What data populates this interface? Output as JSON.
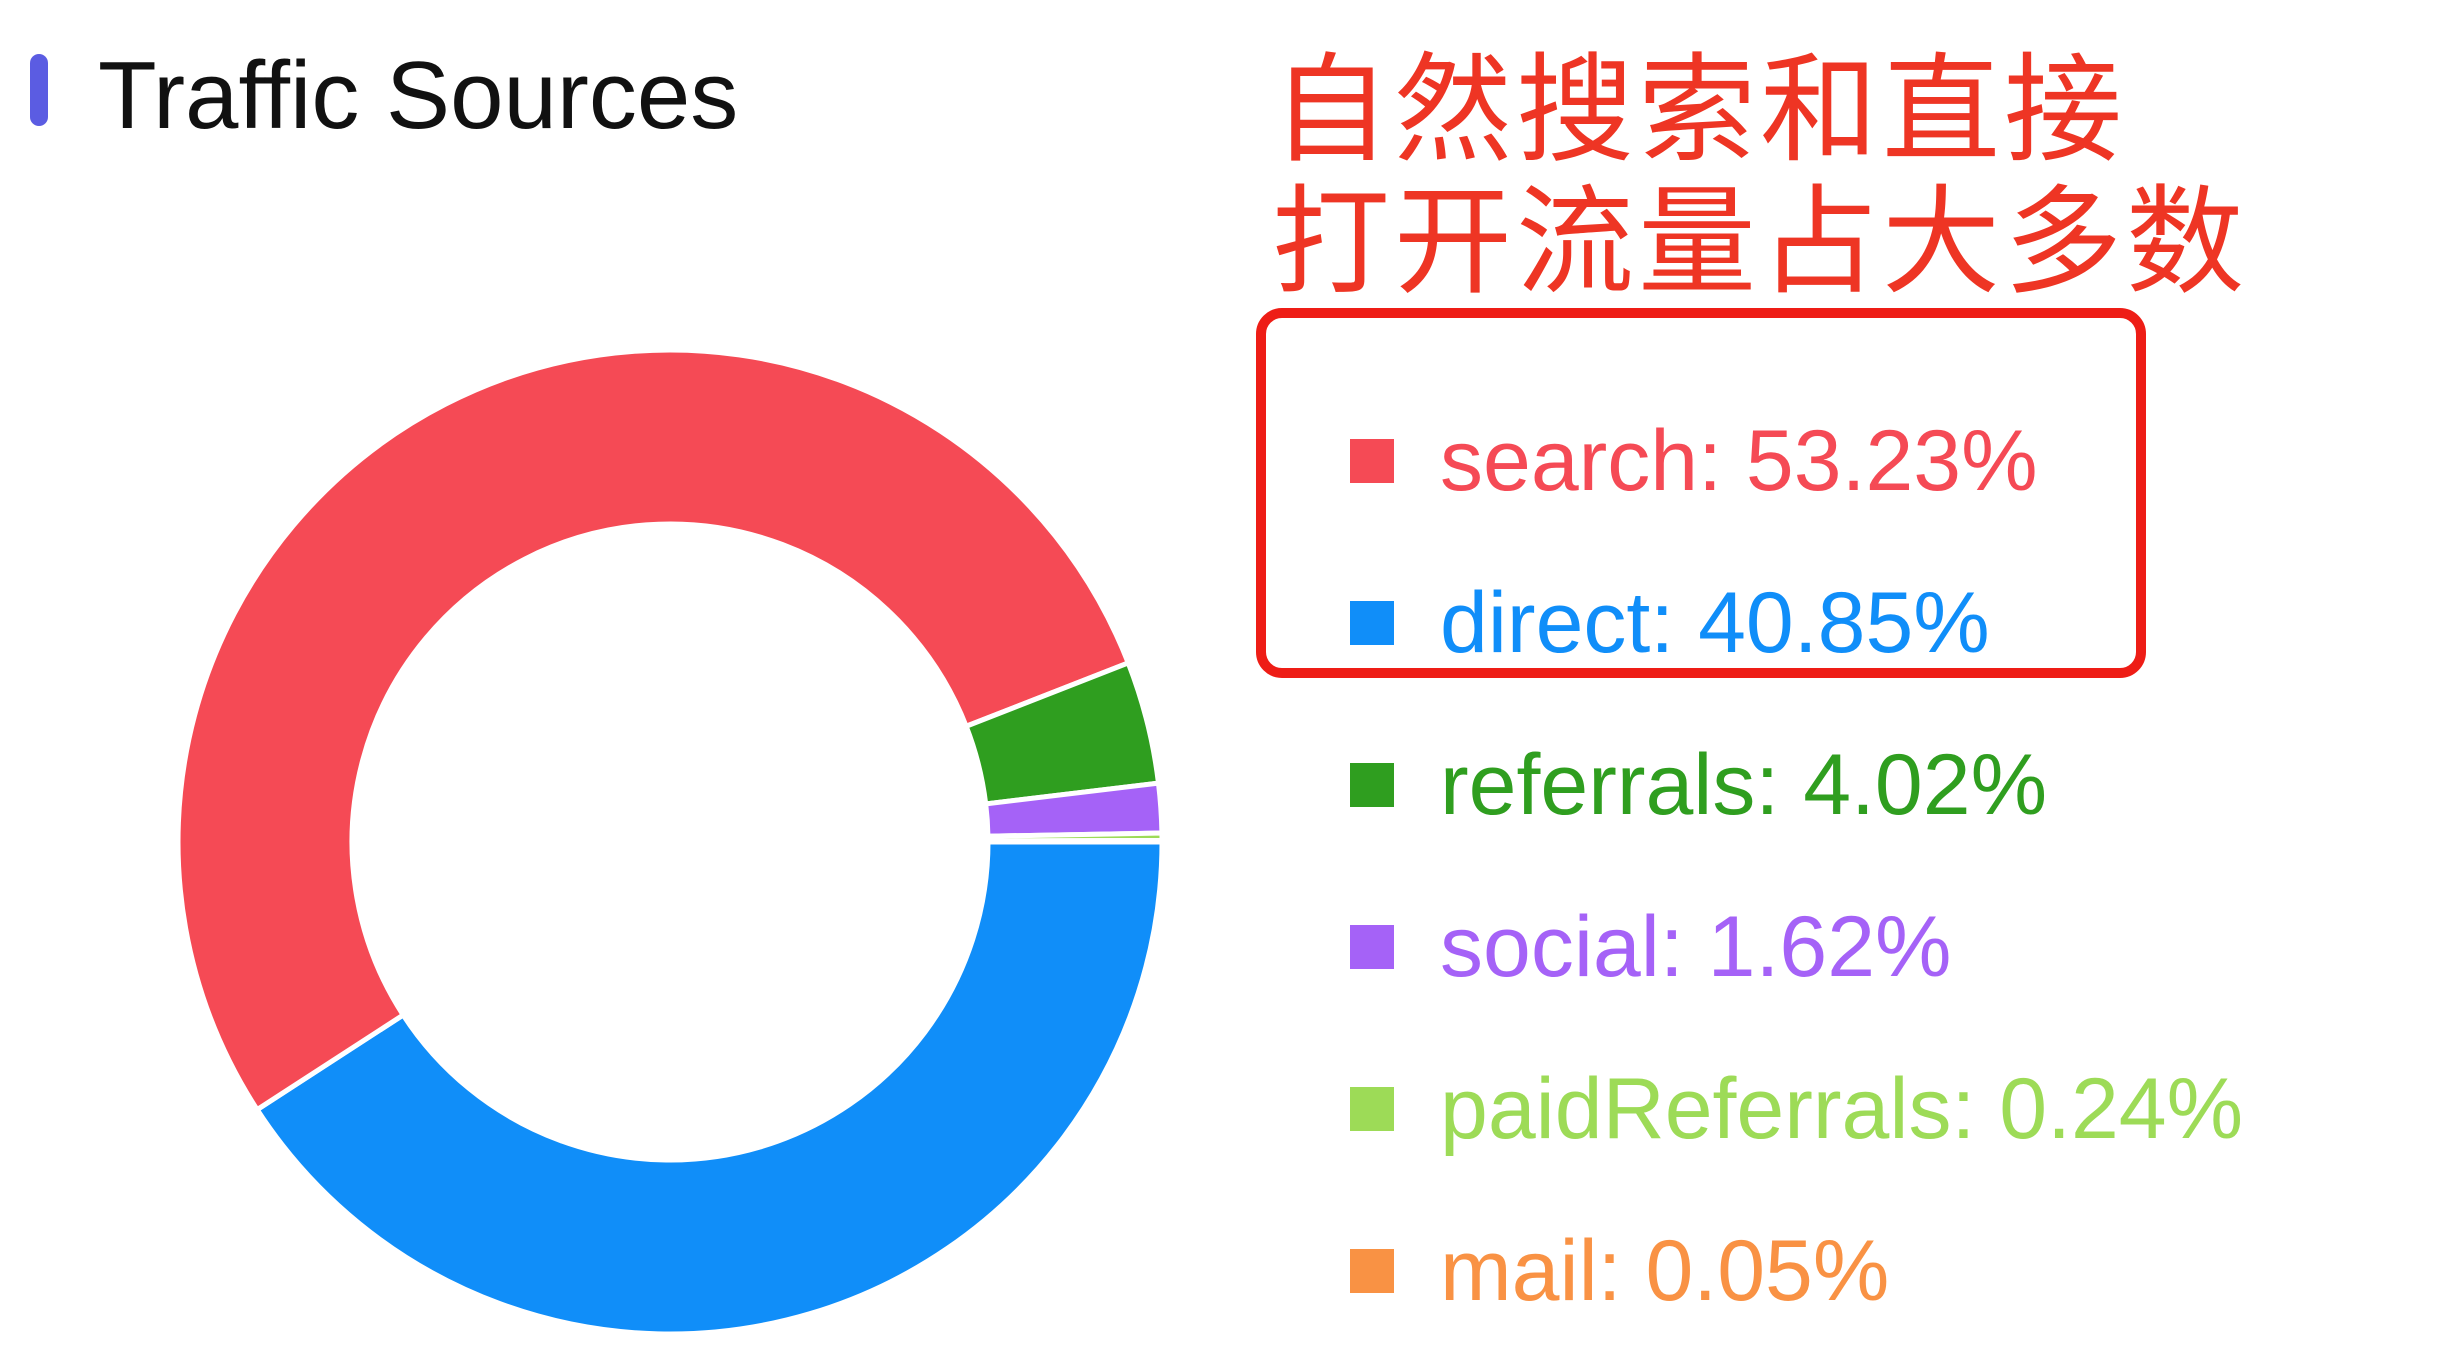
{
  "header": {
    "title": "Traffic Sources",
    "title_bar_color": "#5b5ce2"
  },
  "annotation": {
    "lines": [
      "自然搜索和直接",
      "打开流量占大多数"
    ],
    "color": "#ee3524"
  },
  "highlight_box": {
    "color": "#ee1d16",
    "covers": [
      "search",
      "direct"
    ]
  },
  "chart_data": {
    "type": "pie",
    "variant": "donut",
    "title": "Traffic Sources",
    "legend_position": "right",
    "unit": "%",
    "series": [
      {
        "name": "search",
        "value": 53.23,
        "color": "#f54a55",
        "label": "search: 53.23%"
      },
      {
        "name": "direct",
        "value": 40.85,
        "color": "#108ef9",
        "label": "direct: 40.85%"
      },
      {
        "name": "referrals",
        "value": 4.02,
        "color": "#2f9e1f",
        "label": "referrals: 4.02%"
      },
      {
        "name": "social",
        "value": 1.62,
        "color": "#a562f7",
        "label": "social: 1.62%"
      },
      {
        "name": "paidReferrals",
        "value": 0.24,
        "color": "#9ddb57",
        "label": "paidReferrals: 0.24%"
      },
      {
        "name": "mail",
        "value": 0.05,
        "color": "#f99244",
        "label": "mail: 0.05%"
      }
    ]
  }
}
